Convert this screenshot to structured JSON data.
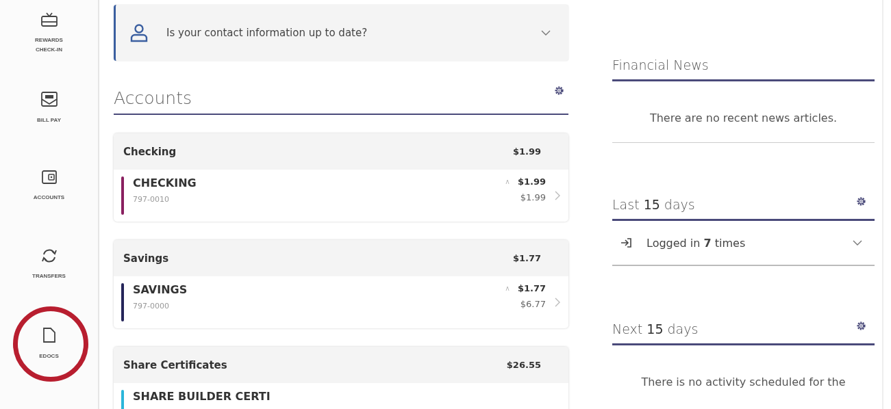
{
  "sidebar": {
    "items": [
      {
        "label": "REWARDS CHECK-IN",
        "kind": "gift",
        "highlighted": false
      },
      {
        "label": "BILL PAY",
        "kind": "bill",
        "highlighted": false
      },
      {
        "label": "ACCOUNTS",
        "kind": "wallet",
        "highlighted": false
      },
      {
        "label": "TRANSFERS",
        "kind": "transfer",
        "highlighted": false
      },
      {
        "label": "EDOCS",
        "kind": "document",
        "highlighted": true
      }
    ]
  },
  "contact_banner": {
    "text": "Is your contact information up to date?",
    "expanded": false
  },
  "accounts": {
    "title": "Accounts",
    "groups": [
      {
        "name": "Checking",
        "total": "$1.99",
        "accounts": [
          {
            "name": "CHECKING",
            "number": "797-0010",
            "balance": "$1.99",
            "available": "$1.99",
            "color": "#8a2060"
          }
        ]
      },
      {
        "name": "Savings",
        "total": "$1.77",
        "accounts": [
          {
            "name": "SAVINGS",
            "number": "797-0000",
            "balance": "$1.77",
            "available": "$6.77",
            "color": "#25255a"
          }
        ]
      },
      {
        "name": "Share Certificates",
        "total": "$26.55",
        "accounts": [
          {
            "name": "SHARE BUILDER CERTI",
            "color": "#2bb6da"
          }
        ]
      }
    ]
  },
  "financial_news": {
    "title": "Financial News",
    "message": "There are no recent news articles."
  },
  "last_days": {
    "title": "Last **15** days",
    "activity": "Logged in **7** times",
    "expanded": false
  },
  "next_days": {
    "title": "Next **15** days",
    "message": "There is no activity scheduled for the"
  }
}
